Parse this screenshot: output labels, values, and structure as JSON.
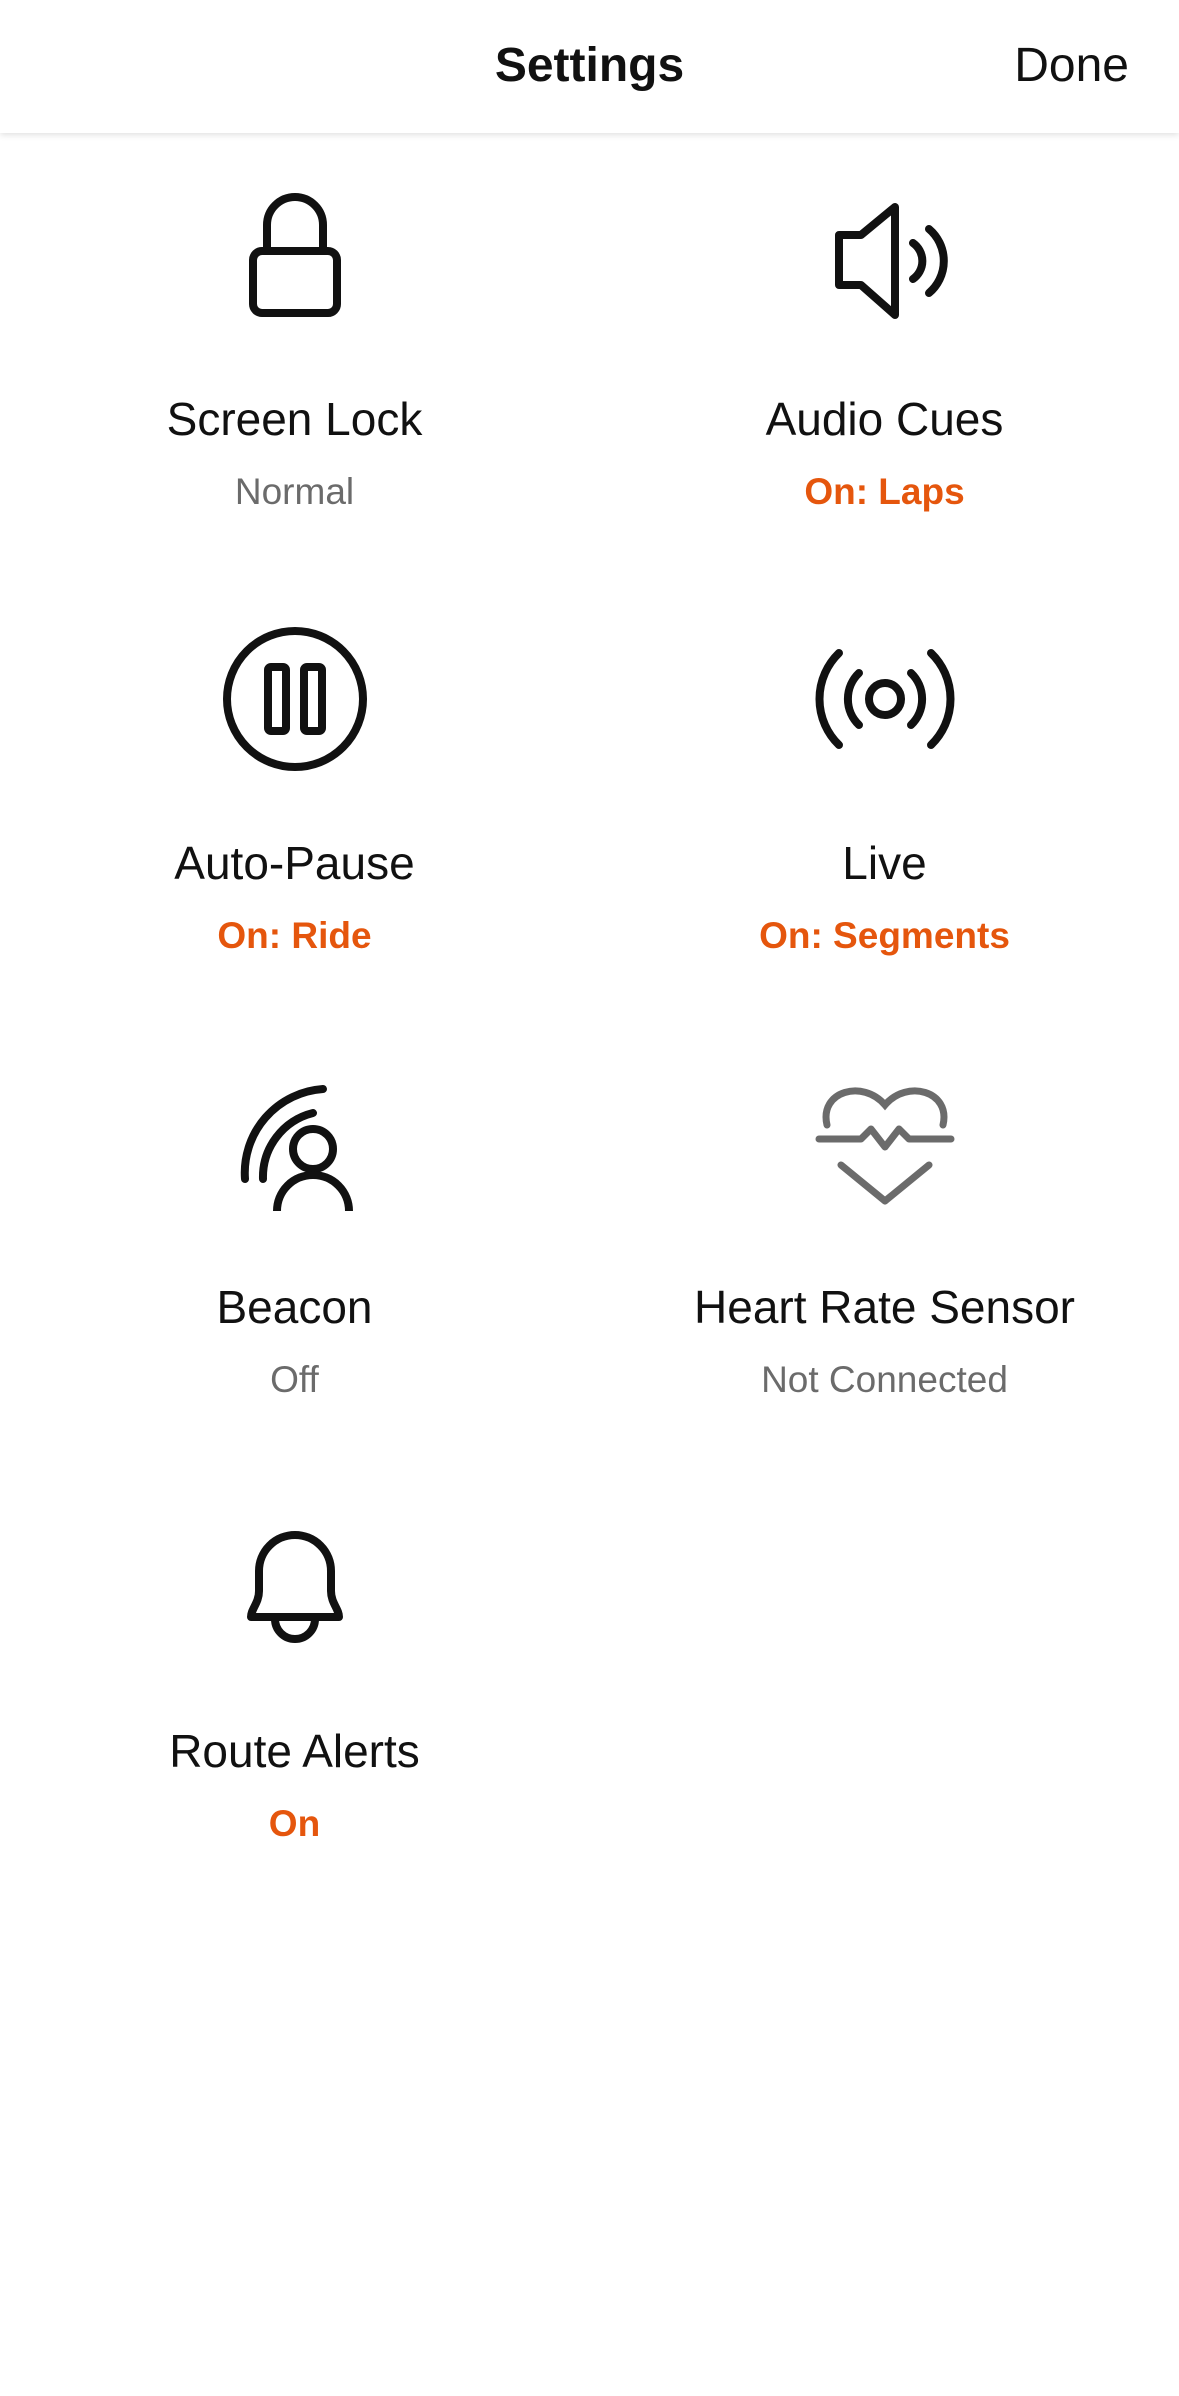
{
  "header": {
    "title": "Settings",
    "done_label": "Done"
  },
  "colors": {
    "accent": "#e5560d",
    "muted": "#6b6b6b",
    "text": "#111111"
  },
  "settings": [
    {
      "label": "Screen Lock",
      "status": "Normal",
      "active": false,
      "icon": "lock-icon"
    },
    {
      "label": "Audio Cues",
      "status": "On: Laps",
      "active": true,
      "icon": "speaker-icon"
    },
    {
      "label": "Auto-Pause",
      "status": "On: Ride",
      "active": true,
      "icon": "pause-icon"
    },
    {
      "label": "Live",
      "status": "On: Segments",
      "active": true,
      "icon": "broadcast-icon"
    },
    {
      "label": "Beacon",
      "status": "Off",
      "active": false,
      "icon": "beacon-icon"
    },
    {
      "label": "Heart Rate Sensor",
      "status": "Not Connected",
      "active": false,
      "icon": "heart-rate-icon"
    },
    {
      "label": "Route Alerts",
      "status": "On",
      "active": true,
      "icon": "bell-icon"
    }
  ]
}
